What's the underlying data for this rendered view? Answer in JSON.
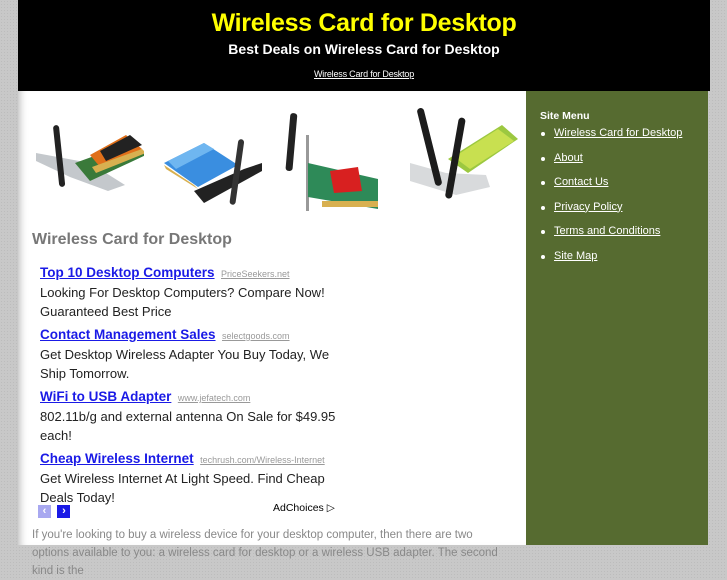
{
  "header": {
    "title": "Wireless Card for Desktop",
    "tagline": "Best Deals on Wireless Card for Desktop",
    "home_link": "Wireless Card for Desktop"
  },
  "main": {
    "product_images": [
      {
        "name": "dlink-pci-wireless-card"
      },
      {
        "name": "blue-pci-wireless-card"
      },
      {
        "name": "red-chip-pci-wireless-card"
      },
      {
        "name": "dual-antenna-pci-wireless-card"
      }
    ],
    "heading": "Wireless Card for Desktop",
    "ads": [
      {
        "title": "Top 10 Desktop Computers",
        "url": "PriceSeekers.net",
        "desc": "Looking For Desktop Computers? Compare Now! Guaranteed Best Price"
      },
      {
        "title": "Contact Management Sales",
        "url": "selectgoods.com",
        "desc": "Get Desktop Wireless Adapter You Buy Today, We Ship Tomorrow."
      },
      {
        "title": "WiFi to USB Adapter",
        "url": "www.jefatech.com",
        "desc": "802.11b/g and external antenna On Sale for $49.95 each!"
      },
      {
        "title": "Cheap Wireless Internet",
        "url": "techrush.com/Wireless-Internet",
        "desc": "Get Wireless Internet At Light Speed. Find Cheap Deals Today!"
      }
    ],
    "ad_nav": {
      "prev": "‹",
      "next": "›"
    },
    "adchoices_label": "AdChoices",
    "adchoices_icon": "▷",
    "intro": "If you're looking to buy a wireless device for your desktop computer, then there are two options available to you: a wireless card for desktop or a wireless USB adapter. The second kind is the"
  },
  "sidebar": {
    "title": "Site Menu",
    "items": [
      {
        "label": "Wireless Card for Desktop"
      },
      {
        "label": "About"
      },
      {
        "label": "Contact Us"
      },
      {
        "label": "Privacy Policy"
      },
      {
        "label": "Terms and Conditions"
      },
      {
        "label": "Site Map"
      }
    ]
  },
  "colors": {
    "title": "#ffff00",
    "header_bg": "#000000",
    "sidebar_bg": "#566b30",
    "ad_link": "#1a1ae6",
    "page_bg": "#c8c8c8"
  }
}
